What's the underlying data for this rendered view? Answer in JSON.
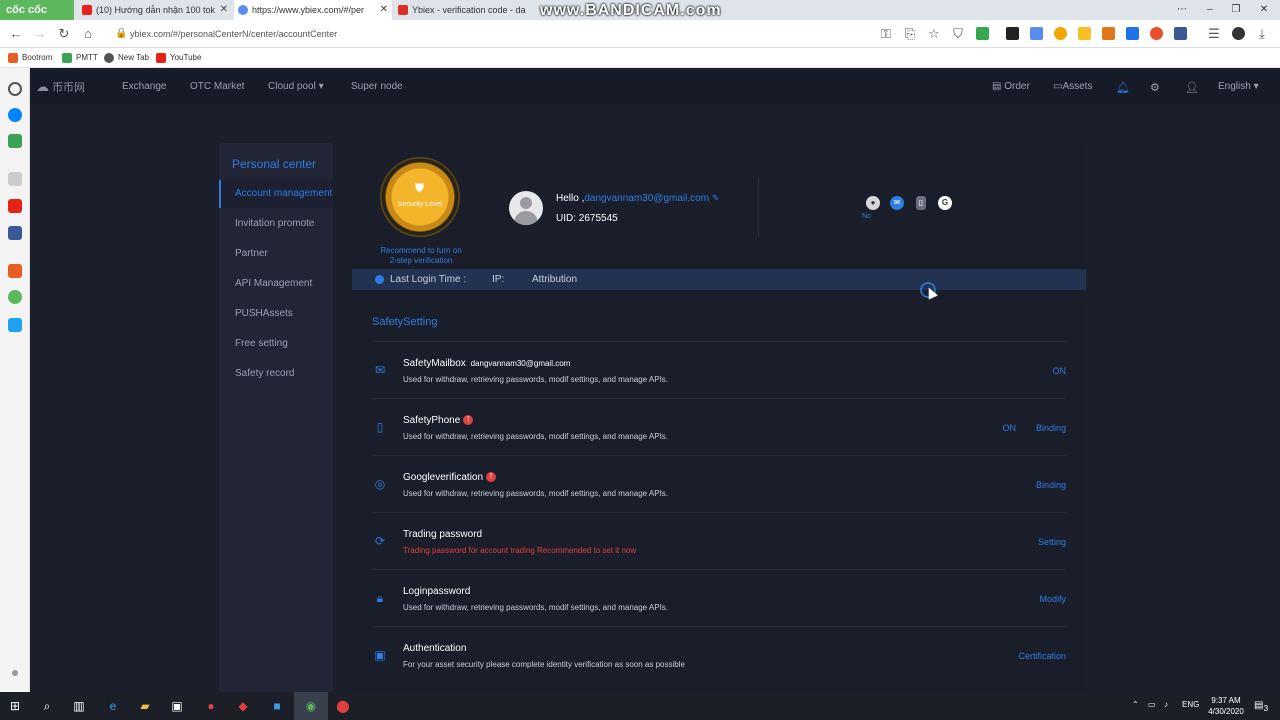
{
  "browser": {
    "brand": "cốc cốc",
    "tabs": [
      {
        "title": "(10) Hướng dẫn nhận 100 tok",
        "icon_color": "#e62117"
      },
      {
        "title": "https://www.ybiex.com/#/per",
        "icon_color": "#5b8def"
      },
      {
        "title": "Ybiex - verification code - da",
        "icon_color": "#d93025"
      }
    ],
    "watermark": "www.BANDICAM.com",
    "url": "ybiex.com/#/personalCenterN/center/accountCenter",
    "bookmarks": [
      "Bootrom",
      "PMTT",
      "New Tab",
      "YouTube"
    ]
  },
  "header": {
    "logo": "币币网",
    "nav": [
      "Exchange",
      "OTC Market",
      "Cloud pool",
      "Super node"
    ],
    "order": "Order",
    "assets": "Assets",
    "language": "English"
  },
  "sidebar": {
    "title": "Personal center",
    "items": [
      "Account management",
      "Invitation promote",
      "Partner",
      "API Management",
      "PUSHAssets",
      "Free setting",
      "Safety record"
    ]
  },
  "profile": {
    "security_level": "Security Level",
    "recommend": "Recommend to turn on 2-step verification",
    "hello": "Hello ,",
    "email": "dangvannam30@gmail.com",
    "uid": "UID: 2675545",
    "verify_no": "No",
    "google_letter": "G"
  },
  "login": {
    "last_login": "Last Login Time :",
    "ip": "IP:",
    "attribution": "Attribution"
  },
  "safety": {
    "title": "SafetySetting",
    "rows": [
      {
        "title": "SafetyMailbox",
        "email": "dangvannam30@gmail.com",
        "desc": "Used for withdraw, retrieving passwords, modif settings, and manage APIs.",
        "action": "ON"
      },
      {
        "title": "SafetyPhone",
        "desc": "Used for withdraw, retrieving passwords, modif settings, and manage APIs.",
        "status": "ON",
        "action": "Binding"
      },
      {
        "title": "Googleverification",
        "desc": "Used for withdraw, retrieving passwords, modif settings, and manage APIs.",
        "action": "Binding"
      },
      {
        "title": "Trading password",
        "desc": "Trading password for account trading Recommended to set it now",
        "action": "Setting"
      },
      {
        "title": "Loginpassword",
        "desc": "Used for withdraw, retrieving passwords, modif settings, and manage APIs.",
        "action": "Modify"
      },
      {
        "title": "Authentication",
        "desc": "For your asset security please complete identity verification as soon as possible",
        "action": "Certification"
      }
    ]
  },
  "taskbar": {
    "lang": "ENG",
    "time": "9:37 AM",
    "date": "4/30/2020",
    "notif": "3"
  }
}
